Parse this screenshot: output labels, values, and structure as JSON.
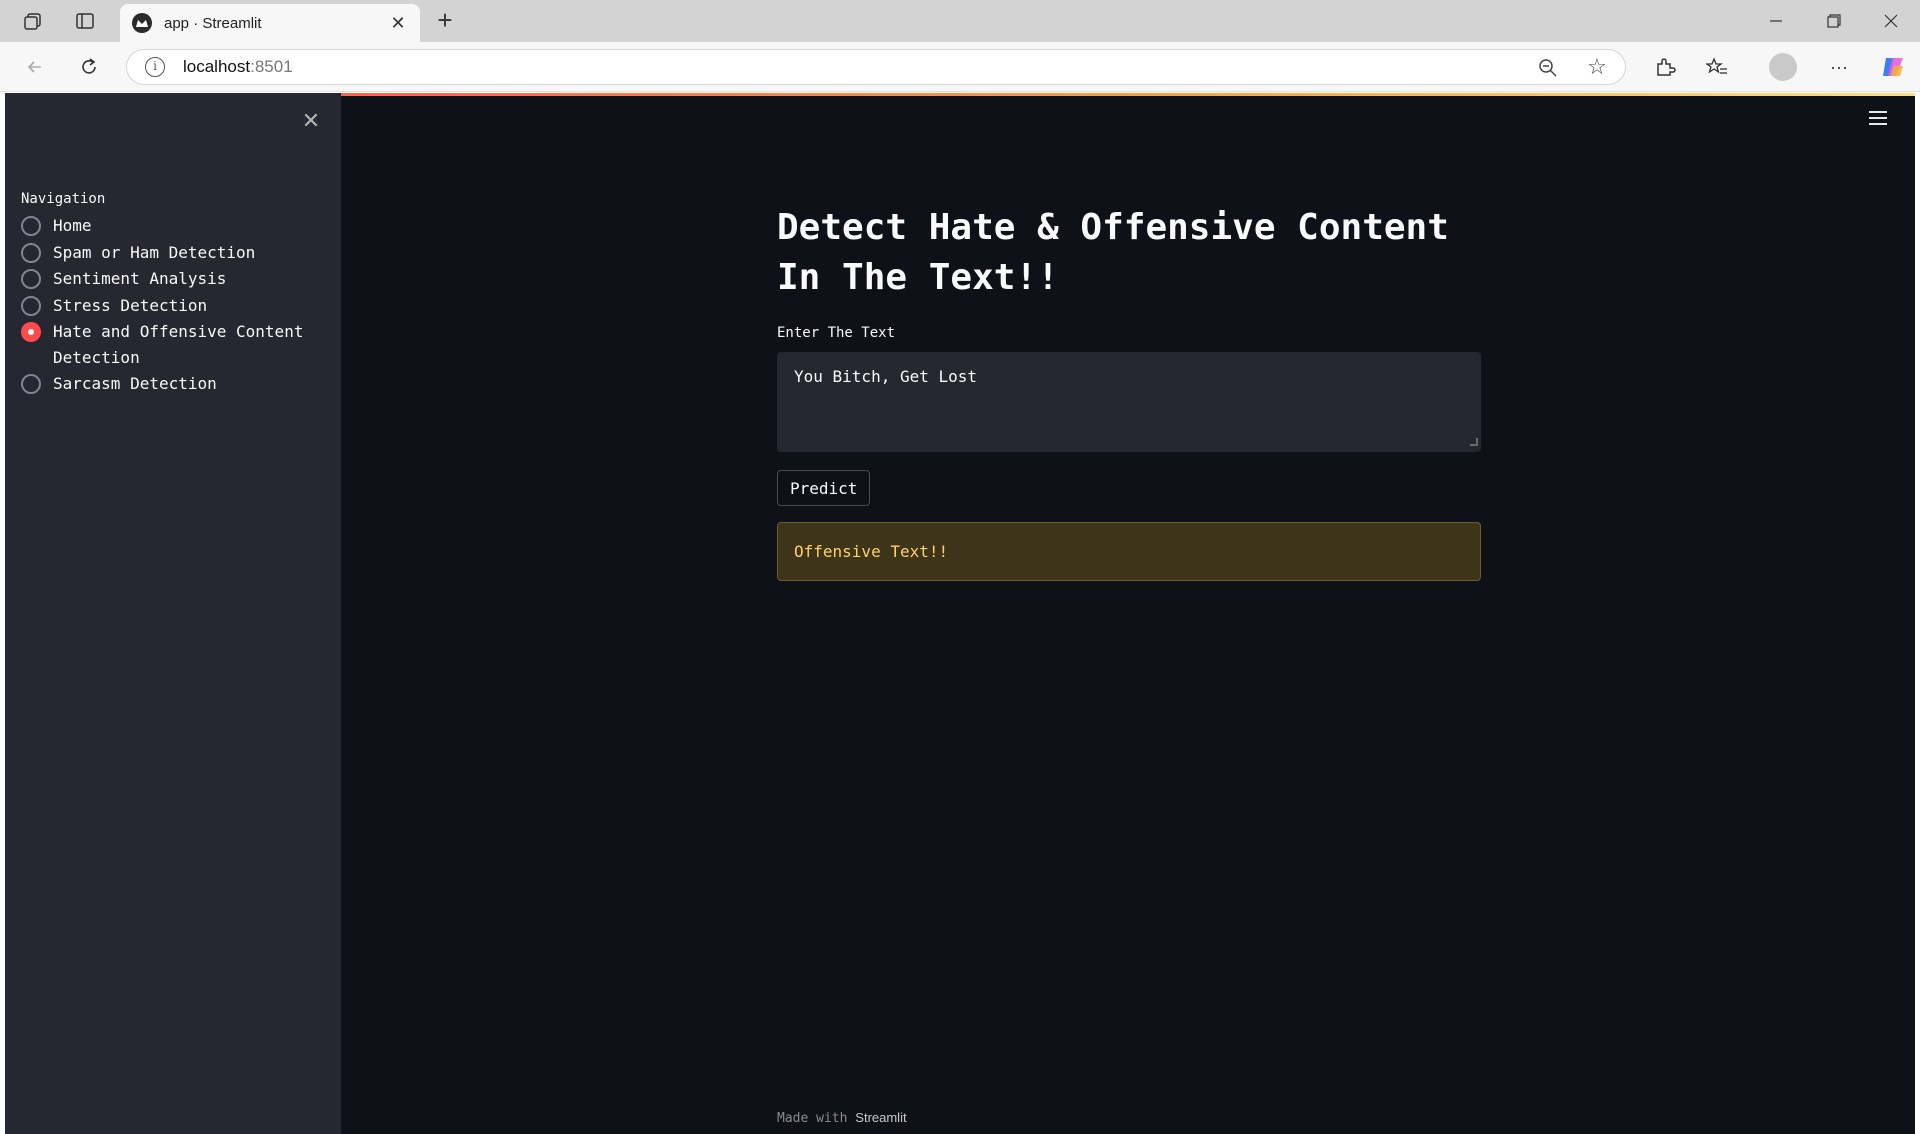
{
  "browser": {
    "tab_title": "app · Streamlit",
    "url_host": "localhost",
    "url_port": ":8501"
  },
  "sidebar": {
    "nav_title": "Navigation",
    "items": [
      {
        "label": "Home",
        "checked": false
      },
      {
        "label": "Spam or Ham Detection",
        "checked": false
      },
      {
        "label": "Sentiment Analysis",
        "checked": false
      },
      {
        "label": "Stress Detection",
        "checked": false
      },
      {
        "label": "Hate and Offensive Content Detection",
        "checked": true
      },
      {
        "label": "Sarcasm Detection",
        "checked": false
      }
    ]
  },
  "main": {
    "title_line1": "Detect Hate & Offensive Content",
    "title_line2": "In The Text!!",
    "input_label": "Enter The Text",
    "input_value": "You Bitch, Get Lost",
    "predict_label": "Predict",
    "result_text": "Offensive Text!!"
  },
  "footer": {
    "made_with": "Made with",
    "brand": "Streamlit"
  },
  "colors": {
    "accent": "#ff4b4b",
    "background": "#0e1117",
    "sidebar": "#262730",
    "warning_bg": "#3e3419",
    "warning_text": "#ffd16a"
  }
}
